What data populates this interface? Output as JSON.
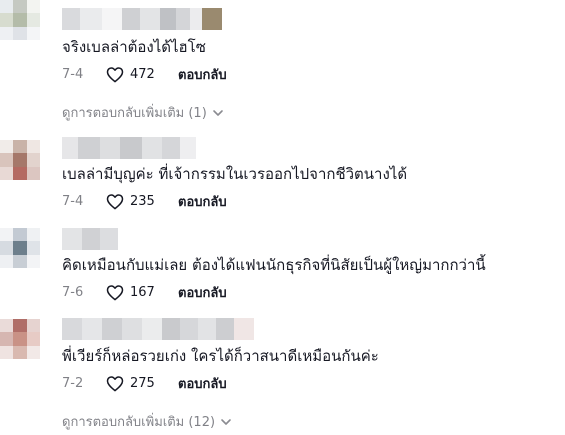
{
  "comments": [
    {
      "text": "จริงเบลล่าต้องได้ไฮโซ",
      "date": "7-4",
      "likes": "472",
      "reply_label": "ตอบกลับ",
      "more_replies": "ดูการตอบกลับเพิ่มเติม (1)"
    },
    {
      "text": "เบลล่ามีบุญค่ะ ที่เจ้ากรรมในเวรออกไปจากชีวิตนางได้",
      "date": "7-4",
      "likes": "235",
      "reply_label": "ตอบกลับ"
    },
    {
      "text": "คิดเหมือนกับแม่เลย ต้องได้แฟนนักธุรกิจที่นิสัยเป็นผู้ใหญ่มากกว่านี้",
      "date": "7-6",
      "likes": "167",
      "reply_label": "ตอบกลับ"
    },
    {
      "text": "พี่เวียร์ก็หล่อรวยเก่ง ใครได้ก็วาสนาดีเหมือนกันค่ะ",
      "date": "7-2",
      "likes": "275",
      "reply_label": "ตอบกลับ",
      "more_replies": "ดูการตอบกลับเพิ่มเติม (12)"
    }
  ],
  "colors": {
    "text_primary": "#161823",
    "text_secondary": "#8a8b91"
  },
  "icons": {
    "like": "heart-outline-icon",
    "expand": "chevron-down-icon"
  }
}
